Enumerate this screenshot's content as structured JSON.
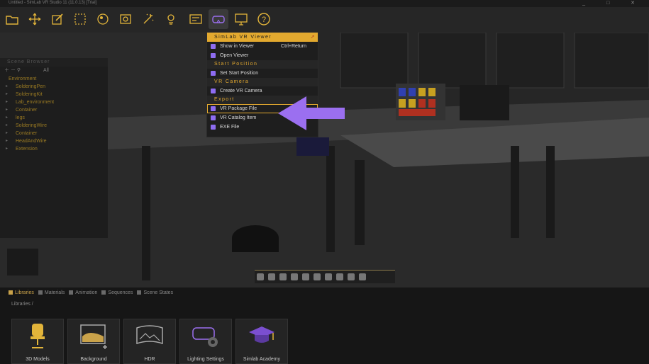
{
  "window": {
    "title": "Untitled - SimLab VR Studio 11 (11.0.13) [Trial]",
    "controls": [
      "_",
      "□",
      "✕"
    ]
  },
  "toolbar": {
    "buttons": [
      {
        "icon": "open-folder-icon"
      },
      {
        "icon": "move-icon"
      },
      {
        "icon": "edit-icon"
      },
      {
        "icon": "select-icon"
      },
      {
        "icon": "materials-icon"
      },
      {
        "icon": "camera-icon"
      },
      {
        "icon": "magic-wand-icon"
      },
      {
        "icon": "light-icon"
      },
      {
        "icon": "storyboard-icon"
      },
      {
        "icon": "vr-headset-icon"
      },
      {
        "icon": "presentation-icon"
      },
      {
        "icon": "help-icon"
      }
    ]
  },
  "scene_browser": {
    "title": "Scene Browser",
    "filter": "All",
    "items": [
      {
        "label": "Environment",
        "root": true
      },
      {
        "label": "SolderingPen"
      },
      {
        "label": "SolderingKit"
      },
      {
        "label": "Lab_environment"
      },
      {
        "label": "Container"
      },
      {
        "label": "legs"
      },
      {
        "label": "SolderingWire"
      },
      {
        "label": "Container"
      },
      {
        "label": "HeadAndWire"
      },
      {
        "label": "Extension"
      }
    ]
  },
  "vr_menu": {
    "header": "SimLab VR Viewer",
    "show_in_viewer": "Show in Viewer",
    "show_shortcut": "Ctrl+Return",
    "open_viewer": "Open Viewer",
    "sec_start": "Start Position",
    "set_start": "Set Start Position",
    "sec_camera": "VR Camera",
    "create_camera": "Create VR Camera",
    "sec_export": "Export",
    "vr_package": "VR Package File",
    "vr_catalog": "VR Catalog Item",
    "exe_file": "EXE File"
  },
  "bottom": {
    "tabs": [
      {
        "label": "Libraries",
        "active": true
      },
      {
        "label": "Materials"
      },
      {
        "label": "Animation"
      },
      {
        "label": "Sequences"
      },
      {
        "label": "Scene States"
      }
    ],
    "breadcrumb": "Libraries  /",
    "tiles": [
      "3D Models",
      "Background",
      "HDR",
      "Lighting Settings",
      "Simlab Academy"
    ]
  },
  "colors": {
    "accent": "#e3a92f",
    "highlight_arrow": "#9b6ff0"
  }
}
